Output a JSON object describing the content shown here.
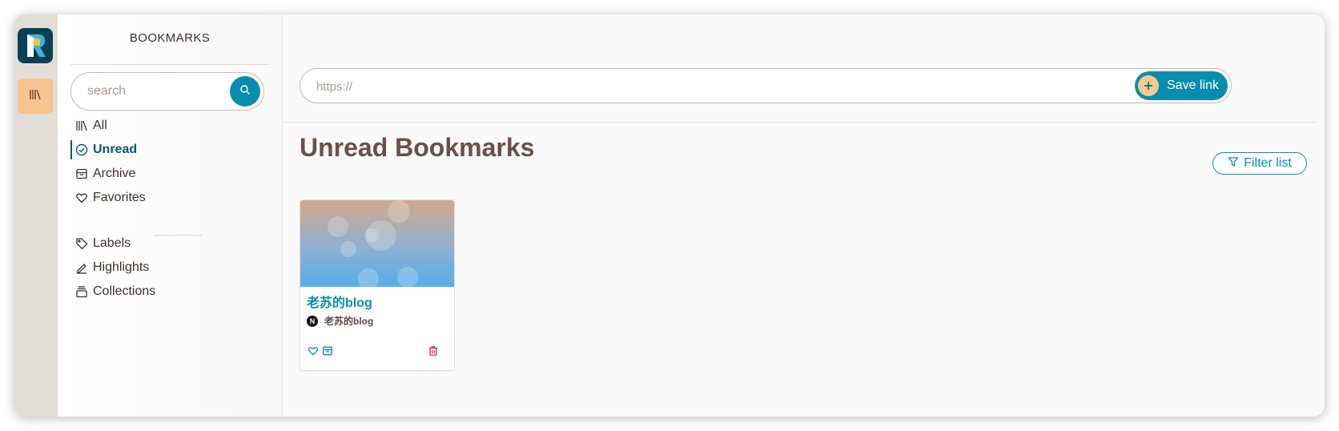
{
  "sidebar": {
    "title": "BOOKMARKS",
    "search_placeholder": "search",
    "nav": [
      {
        "label": "All",
        "icon": "library-icon",
        "active": false
      },
      {
        "label": "Unread",
        "icon": "check-circle-icon",
        "active": true
      },
      {
        "label": "Archive",
        "icon": "archive-icon",
        "active": false
      },
      {
        "label": "Favorites",
        "icon": "heart-icon",
        "active": false
      }
    ],
    "nav2": [
      {
        "label": "Labels",
        "icon": "tag-icon"
      },
      {
        "label": "Highlights",
        "icon": "highlighter-icon"
      },
      {
        "label": "Collections",
        "icon": "collections-icon"
      }
    ]
  },
  "url_bar": {
    "placeholder": "https://",
    "save_label": "Save link"
  },
  "main": {
    "title": "Unread Bookmarks",
    "filter_label": "Filter list"
  },
  "cards": [
    {
      "title": "老苏的blog",
      "site": "老苏的blog",
      "favicon_letter": "N"
    }
  ],
  "colors": {
    "accent": "#0a8dac",
    "active_nav": "#0b5578",
    "title_brown": "#6b5048",
    "rail_active": "#f6c391",
    "delete": "#d9254a"
  }
}
